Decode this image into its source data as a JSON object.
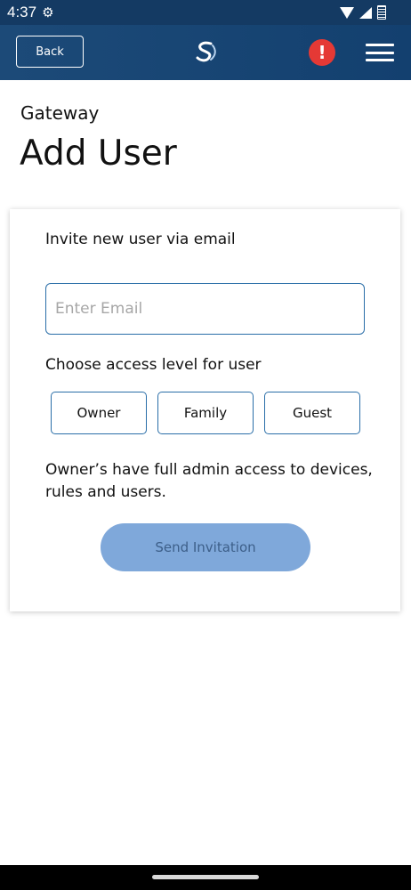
{
  "status_bar": {
    "time": "4:37",
    "icons": [
      "gear-icon",
      "wifi-icon",
      "signal-icon",
      "battery-icon"
    ]
  },
  "header": {
    "back_label": "Back",
    "logo": "brand-logo",
    "alert_symbol": "!",
    "menu_icon": "hamburger-menu-icon",
    "colors": {
      "bar": "#143a63",
      "alert": "#e53935"
    }
  },
  "page": {
    "subtitle": "Gateway",
    "title": "Add User"
  },
  "form": {
    "invite_label": "Invite new user via email",
    "email": {
      "value": "",
      "placeholder": "Enter Email"
    },
    "access_label": "Choose access level for user",
    "access_options": [
      "Owner",
      "Family",
      "Guest"
    ],
    "description": "Owner’s have full admin access to devices, rules and users.",
    "send_label": "Send Invitation",
    "colors": {
      "accent": "#2a6ea8",
      "send_button": "#7fa8da"
    }
  }
}
